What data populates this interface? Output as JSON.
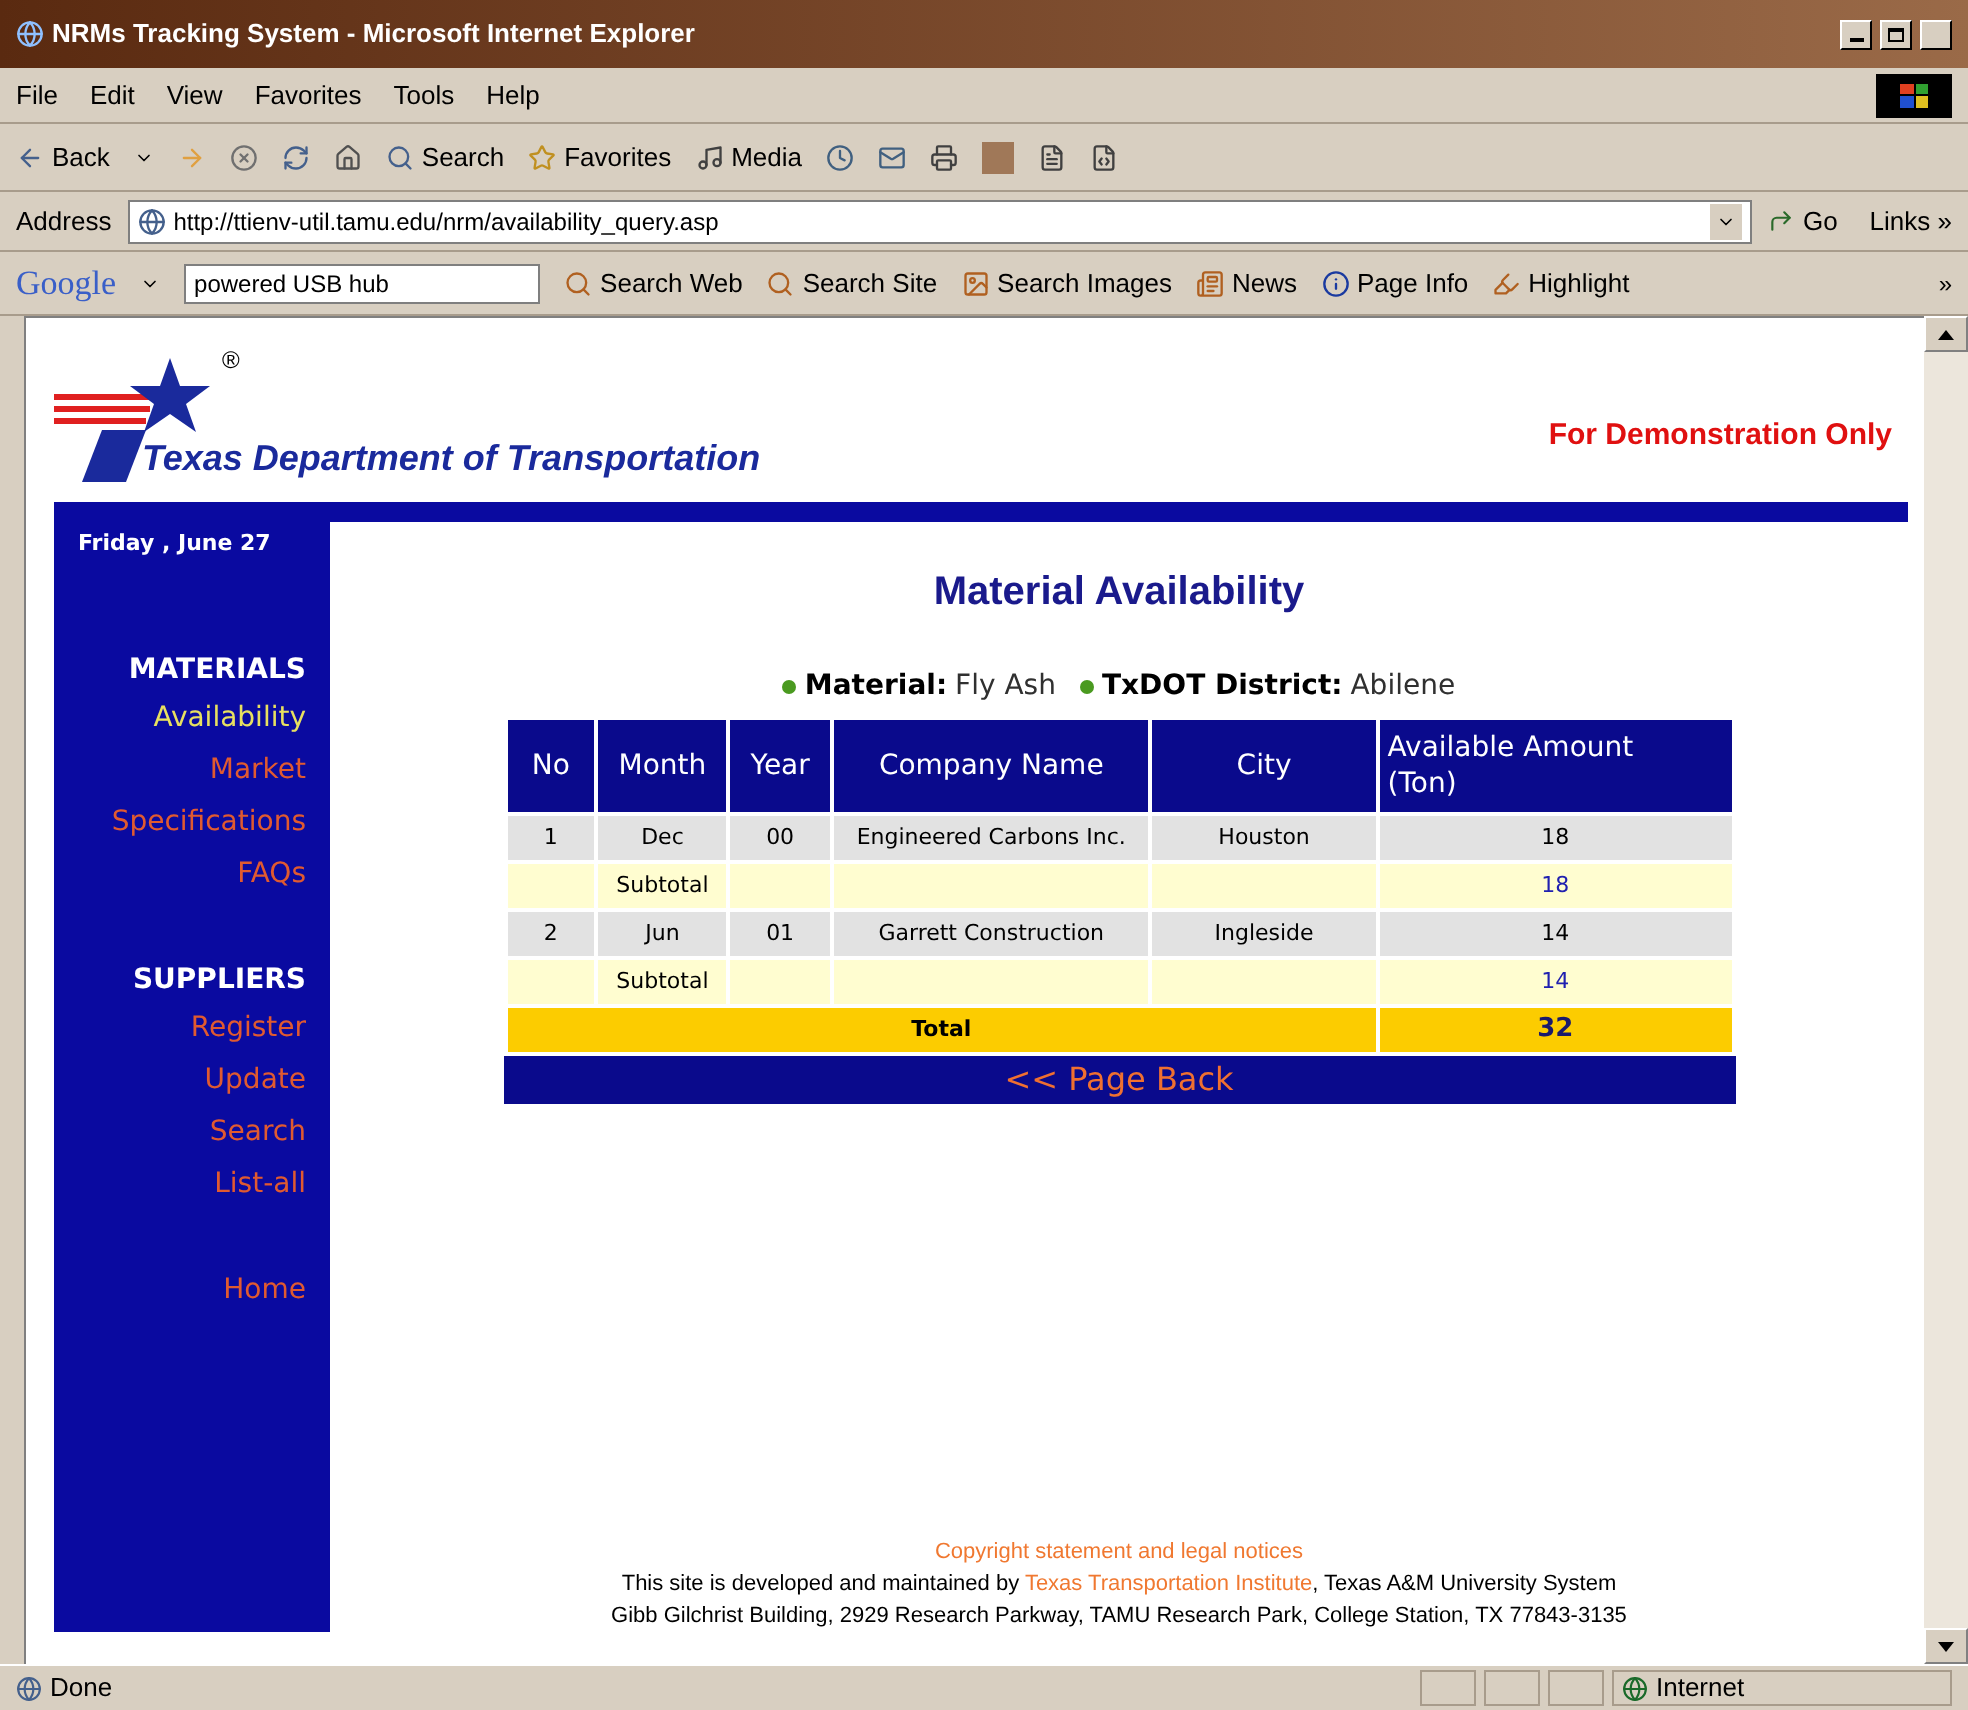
{
  "window": {
    "title": "NRMs Tracking System - Microsoft Internet Explorer"
  },
  "menu": [
    "File",
    "Edit",
    "View",
    "Favorites",
    "Tools",
    "Help"
  ],
  "toolbar": {
    "back": "Back",
    "search": "Search",
    "favorites": "Favorites",
    "media": "Media"
  },
  "address_bar": {
    "label": "Address",
    "url": "http://ttienv-util.tamu.edu/nrm/availability_query.asp",
    "go": "Go",
    "links": "Links »"
  },
  "google_bar": {
    "logo": "Google",
    "query": "powered USB hub",
    "buttons": [
      "Search Web",
      "Search Site",
      "Search Images",
      "News",
      "Page Info",
      "Highlight"
    ],
    "more": "»"
  },
  "header": {
    "logo_mark": "®",
    "agency": "Texas Department of Transportation",
    "notice": "For Demonstration Only"
  },
  "sidebar": {
    "date": "Friday , June 27",
    "sections": [
      {
        "title": "MATERIALS",
        "items": [
          {
            "label": "Availability",
            "selected": true
          },
          {
            "label": "Market",
            "selected": false
          },
          {
            "label": "Specifications",
            "selected": false
          },
          {
            "label": "FAQs",
            "selected": false
          }
        ]
      },
      {
        "title": "SUPPLIERS",
        "items": [
          {
            "label": "Register",
            "selected": false
          },
          {
            "label": "Update",
            "selected": false
          },
          {
            "label": "Search",
            "selected": false
          },
          {
            "label": "List-all",
            "selected": false
          }
        ]
      }
    ],
    "home": "Home"
  },
  "page_title": "Material Availability",
  "filters": [
    {
      "label": "Material:",
      "value": "Fly Ash"
    },
    {
      "label": "TxDOT District:",
      "value": "Abilene"
    }
  ],
  "table": {
    "columns": [
      "No",
      "Month",
      "Year",
      "Company Name",
      "City",
      "Available Amount (Ton)"
    ],
    "rows": [
      {
        "kind": "item",
        "cells": [
          "1",
          "Dec",
          "00",
          "Engineered Carbons Inc.",
          "Houston",
          "18"
        ]
      },
      {
        "kind": "subtotal",
        "label": "Subtotal",
        "amount": "18"
      },
      {
        "kind": "item",
        "cells": [
          "2",
          "Jun",
          "01",
          "Garrett Construction",
          "Ingleside",
          "14"
        ]
      },
      {
        "kind": "subtotal",
        "label": "Subtotal",
        "amount": "14"
      },
      {
        "kind": "total",
        "label": "Total",
        "amount": "32"
      }
    ],
    "back": "<< Page Back"
  },
  "footer": {
    "copyright": "Copyright statement and legal notices",
    "developed_prefix": "This site is developed and maintained by ",
    "developed_link": "Texas Transportation Institute",
    "developed_suffix": ", Texas A&M University System",
    "address": "Gibb Gilchrist Building, 2929 Research Parkway, TAMU Research Park, College Station, TX 77843-3135"
  },
  "status_bar": {
    "text": "Done",
    "zone": "Internet"
  }
}
